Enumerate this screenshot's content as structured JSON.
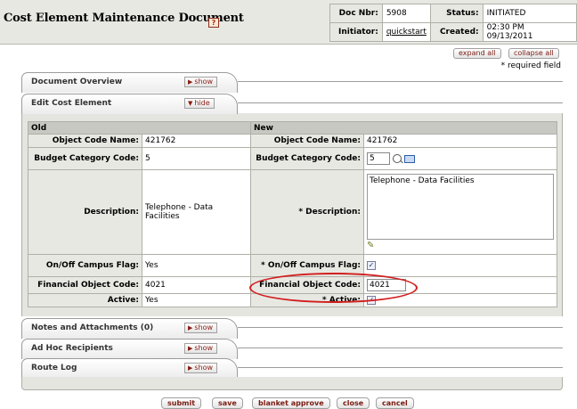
{
  "header": {
    "title": "Cost Element Maintenance Document",
    "help": "?",
    "doc_nbr_label": "Doc Nbr:",
    "doc_nbr": "5908",
    "status_label": "Status:",
    "status": "INITIATED",
    "initiator_label": "Initiator:",
    "initiator": "quickstart",
    "created_label": "Created:",
    "created": "02:30 PM 09/13/2011"
  },
  "controls": {
    "expand_all": "expand all",
    "collapse_all": "collapse all",
    "required_note": "* required field"
  },
  "tabs": [
    {
      "label": "Document Overview",
      "toggle": "show"
    },
    {
      "label": "Edit Cost Element",
      "toggle": "hide"
    },
    {
      "label": "Notes and Attachments (0)",
      "toggle": "show"
    },
    {
      "label": "Ad Hoc Recipients",
      "toggle": "show"
    },
    {
      "label": "Route Log",
      "toggle": "show"
    }
  ],
  "edit": {
    "old_header": "Old",
    "new_header": "New",
    "object_code_name_label": "Object Code Name:",
    "budget_category_code_label": "Budget Category Code:",
    "description_label": "Description:",
    "description_label_new": "* Description:",
    "campus_flag_label": "On/Off Campus Flag:",
    "campus_flag_label_new": "* On/Off Campus Flag:",
    "financial_object_code_label": "Financial Object Code:",
    "active_label": "Active:",
    "active_label_new": "* Active:",
    "old": {
      "object_code_name": "421762",
      "budget_category_code": "5",
      "description": "Telephone - Data Facilities",
      "campus_flag": "Yes",
      "financial_object_code": "4021",
      "active": "Yes"
    },
    "new": {
      "object_code_name": "421762",
      "budget_category_code": "5",
      "description": "Telephone - Data Facilities",
      "campus_flag_checked": "✓",
      "financial_object_code": "4021",
      "active_checked": "✓"
    }
  },
  "footer_buttons": {
    "submit": "submit",
    "save": "save",
    "blanket_approve": "blanket approve",
    "close": "close",
    "cancel": "cancel"
  },
  "colors": {
    "header_bg": "#e8e8e3",
    "button_text": "#7a1a10",
    "highlight": "#d11e1e"
  }
}
